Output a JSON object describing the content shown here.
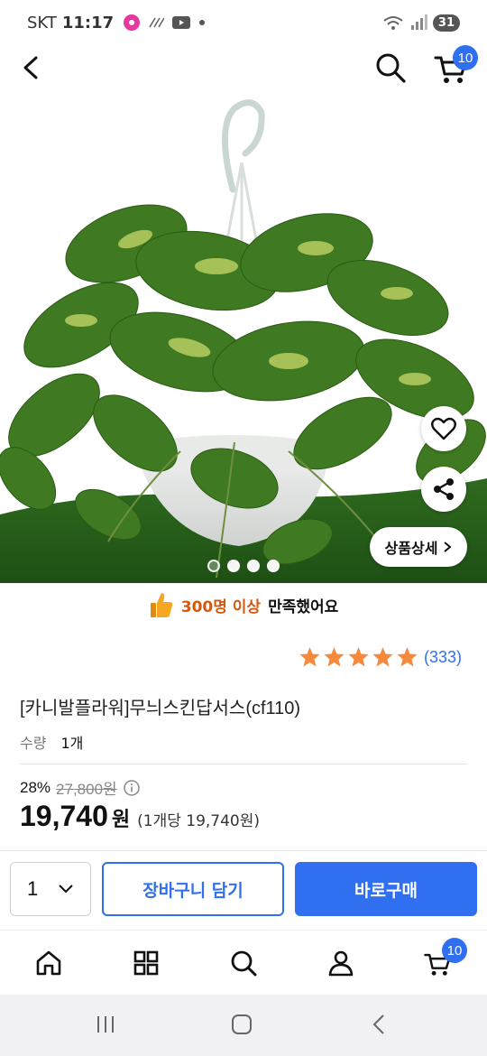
{
  "status_bar": {
    "carrier": "SKT",
    "time": "11:17",
    "battery": "31"
  },
  "header": {
    "cart_count": "10"
  },
  "hero": {
    "detail_button": "상품상세",
    "image_count": 4,
    "active_image": 1
  },
  "satisfaction": {
    "highlight": "300명 이상",
    "text": "만족했어요"
  },
  "rating": {
    "stars": 5,
    "count": "(333)"
  },
  "product": {
    "title": "[카니발플라워]무늬스킨답서스(cf110)",
    "qty_label": "수량",
    "qty_value": "1개",
    "discount": "28%",
    "original_price": "27,800원",
    "price": "19,740",
    "currency": "원",
    "unit_price": "(1개당 19,740원)"
  },
  "actions": {
    "qty": "1",
    "cart_label": "장바구니 담기",
    "buy_label": "바로구매"
  },
  "bottom_nav": {
    "cart_count": "10"
  },
  "colors": {
    "accent": "#2f6ff0",
    "highlight": "#d15a12",
    "star": "#f58a3c"
  }
}
